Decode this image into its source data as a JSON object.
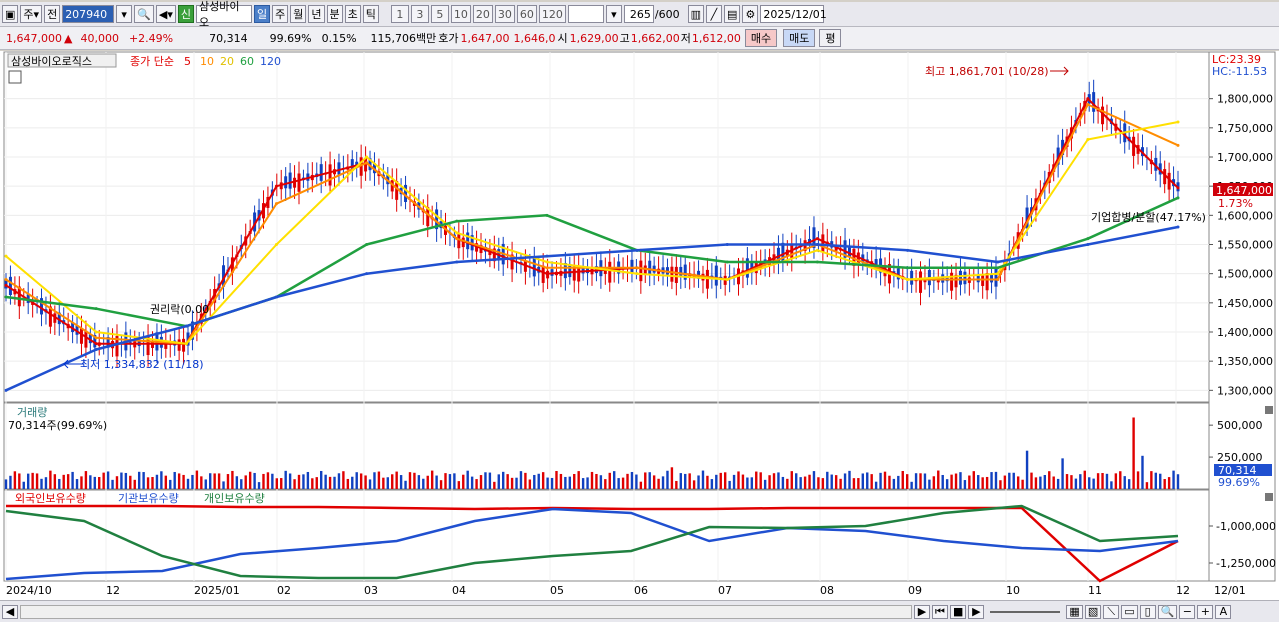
{
  "toolbar": {
    "period_selector": "주",
    "prev_button": "전",
    "stock_code": "207940",
    "new_badge": "신",
    "stock_name": "삼성바이오",
    "period_tabs": [
      "일",
      "주",
      "월",
      "년",
      "분",
      "초",
      "틱"
    ],
    "active_period": "일",
    "interval_buttons": [
      "1",
      "3",
      "5",
      "10",
      "20",
      "30",
      "60",
      "120"
    ],
    "count_display": "265",
    "count_total": "/600",
    "date_value": "2025/12/01"
  },
  "quote": {
    "price": "1,647,000",
    "change": "40,000",
    "change_pct": "+2.49%",
    "volume": "70,314",
    "volume_ratio": "99.69%",
    "turnover": "0.15%",
    "amount": "115,706백만",
    "ask_label": "호가",
    "ask1": "1,647,00",
    "ask2": "1,646,0",
    "open_label": "시",
    "open": "1,629,00",
    "high_label": "고",
    "high": "1,662,00",
    "low_label": "저",
    "low": "1,612,00",
    "buy_label": "매수",
    "sell_label": "매도",
    "avg_label": "평"
  },
  "price_pane": {
    "title": "삼성바이오로직스",
    "ma_label": "종가 단순",
    "ma_periods": [
      "5",
      "10",
      "20",
      "60",
      "120"
    ],
    "ma_colors": [
      "#e00000",
      "#ff8c00",
      "#ffe000",
      "#20a040",
      "#2050d0"
    ],
    "lc_label": "LC:23.39",
    "hc_label": "HC:-11.53",
    "high_annotation": "최고 1,861,701 (10/28)",
    "low_annotation": "최저 1,334,832 (11/18)",
    "split_annotation": "기업합병/분할(47.17%)",
    "rights_annotation": "권리락(0.00",
    "current_price_tag": "1,647,000",
    "current_pct_tag": "1.73%",
    "y_ticks": [
      "1,800,000",
      "1,750,000",
      "1,700,000",
      "1,650,000",
      "1,600,000",
      "1,550,000",
      "1,500,000",
      "1,450,000",
      "1,400,000",
      "1,350,000",
      "1,300,000"
    ]
  },
  "volume_pane": {
    "title": "거래량",
    "summary": "70,314주(99.69%)",
    "y_ticks": [
      "500,000",
      "250,000"
    ],
    "current_tag": "70,314",
    "current_pct": "99.69%"
  },
  "holdings_pane": {
    "legends": [
      "외국인보유수량",
      "기관보유수량",
      "개인보유수량"
    ],
    "legend_colors": [
      "#e00000",
      "#2050d0",
      "#208040"
    ],
    "y_ticks": [
      "-1,000,000",
      "-1,250,000"
    ]
  },
  "x_axis_labels": [
    "2024/10",
    "12",
    "2025/01",
    "02",
    "03",
    "04",
    "05",
    "06",
    "07",
    "08",
    "09",
    "10",
    "11",
    "12",
    "12/01"
  ],
  "chart_data": {
    "type": "line",
    "title": "삼성바이오로직스",
    "x": [
      "2024/10",
      "12",
      "2025/01",
      "02",
      "03",
      "04",
      "05",
      "06",
      "07",
      "08",
      "09",
      "10",
      "11",
      "12"
    ],
    "series": [
      {
        "name": "5",
        "values": [
          1480000,
          1380000,
          1380000,
          1650000,
          1690000,
          1560000,
          1500000,
          1510000,
          1490000,
          1560000,
          1490000,
          1490000,
          1800000,
          1647000
        ]
      },
      {
        "name": "10",
        "values": [
          1490000,
          1390000,
          1380000,
          1620000,
          1690000,
          1560000,
          1510000,
          1510000,
          1490000,
          1550000,
          1490000,
          1490000,
          1790000,
          1720000
        ]
      },
      {
        "name": "20",
        "values": [
          1530000,
          1400000,
          1380000,
          1550000,
          1700000,
          1570000,
          1520000,
          1500000,
          1490000,
          1540000,
          1490000,
          1500000,
          1730000,
          1760000
        ]
      },
      {
        "name": "60",
        "values": [
          1460000,
          1440000,
          1410000,
          1460000,
          1550000,
          1590000,
          1600000,
          1540000,
          1520000,
          1520000,
          1510000,
          1510000,
          1560000,
          1630000
        ]
      },
      {
        "name": "120",
        "values": [
          1300000,
          1370000,
          1410000,
          1460000,
          1500000,
          1520000,
          1530000,
          1540000,
          1550000,
          1550000,
          1540000,
          1520000,
          1550000,
          1580000
        ]
      }
    ],
    "ylim": [
      1280000,
      1880000
    ],
    "grid": true
  }
}
